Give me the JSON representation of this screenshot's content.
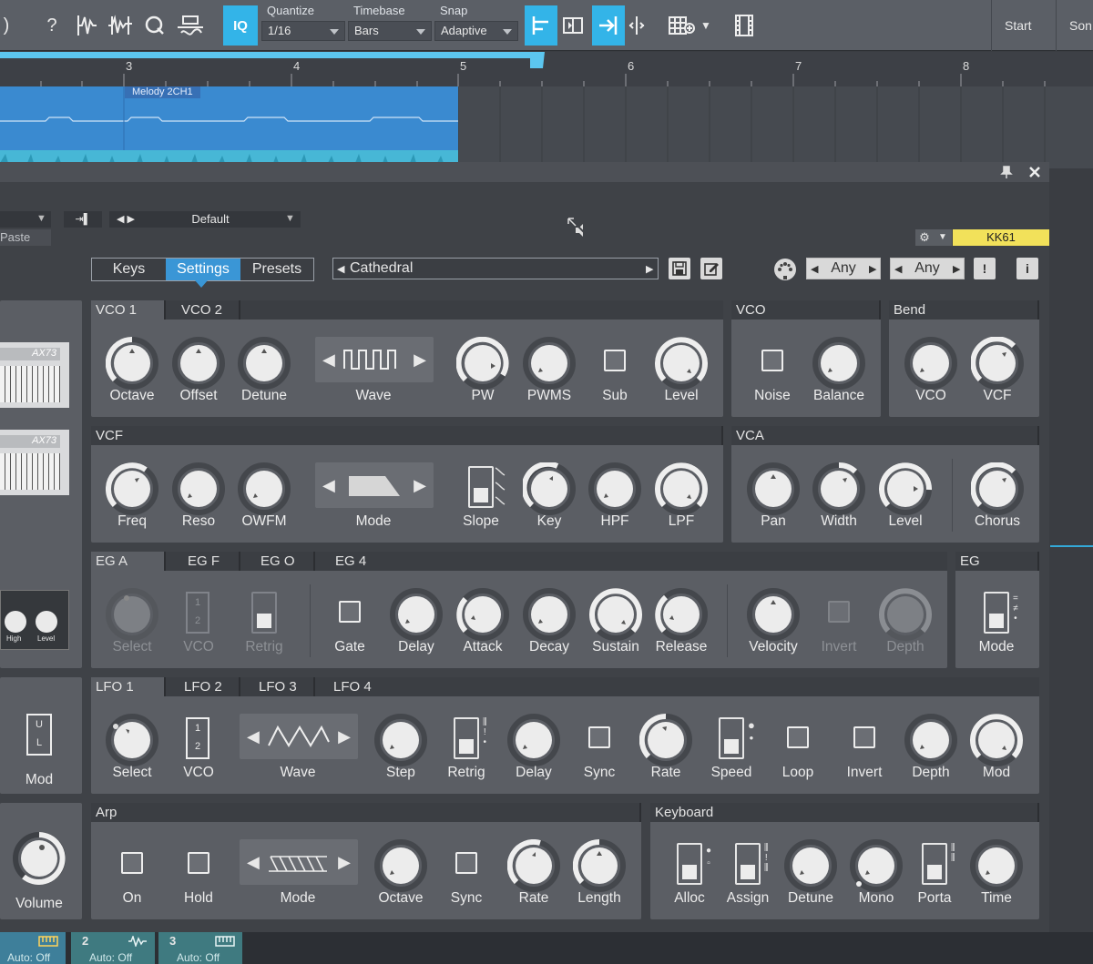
{
  "toolbar": {
    "quantize": {
      "label": "Quantize",
      "value": "1/16"
    },
    "timebase": {
      "label": "Timebase",
      "value": "Bars"
    },
    "snap": {
      "label": "Snap",
      "value": "Adaptive"
    },
    "iq_label": "IQ",
    "start_label": "Start",
    "song_label": "Son"
  },
  "ruler": {
    "bars": [
      "3",
      "4",
      "5",
      "6",
      "7",
      "8"
    ]
  },
  "clip": {
    "name": "Melody 2CH1"
  },
  "plugin": {
    "preset_default": "Default",
    "paste_label": "Paste",
    "device": "KK61",
    "tabs": [
      "Keys",
      "Settings",
      "Presets"
    ],
    "active_tab": "Settings",
    "preset_name": "Cathedral",
    "channel_any_1": "Any",
    "channel_any_2": "Any",
    "warn_label": "!",
    "info_label": "i"
  },
  "preview": {
    "model1": "AX73",
    "model2": "AX73",
    "knob_high": "High",
    "knob_level": "Level",
    "mod": "Mod",
    "volume": "Volume"
  },
  "vco": {
    "tabs": [
      "VCO 1",
      "VCO 2"
    ],
    "controls": {
      "octave": "Octave",
      "offset": "Offset",
      "detune": "Detune",
      "wave": "Wave",
      "pw": "PW",
      "pwms": "PWMS",
      "sub": "Sub",
      "level": "Level"
    }
  },
  "vco_mix": {
    "title": "VCO",
    "noise": "Noise",
    "balance": "Balance"
  },
  "bend": {
    "title": "Bend",
    "vco": "VCO",
    "vcf": "VCF"
  },
  "vcf": {
    "title": "VCF",
    "freq": "Freq",
    "reso": "Reso",
    "owfm": "OWFM",
    "mode": "Mode",
    "slope": "Slope",
    "key": "Key",
    "hpf": "HPF",
    "lpf": "LPF"
  },
  "vca": {
    "title": "VCA",
    "pan": "Pan",
    "width": "Width",
    "level": "Level",
    "chorus": "Chorus"
  },
  "eg": {
    "tabs": [
      "EG A",
      "EG F",
      "EG O",
      "EG 4"
    ],
    "select": "Select",
    "vco": "VCO",
    "retrig": "Retrig",
    "gate": "Gate",
    "delay": "Delay",
    "attack": "Attack",
    "decay": "Decay",
    "sustain": "Sustain",
    "release": "Release",
    "velocity": "Velocity",
    "invert": "Invert",
    "depth": "Depth"
  },
  "eg_mode": {
    "title": "EG",
    "mode": "Mode"
  },
  "lfo": {
    "tabs": [
      "LFO 1",
      "LFO 2",
      "LFO 3",
      "LFO 4"
    ],
    "select": "Select",
    "vco": "VCO",
    "wave": "Wave",
    "step": "Step",
    "retrig": "Retrig",
    "delay": "Delay",
    "sync": "Sync",
    "rate": "Rate",
    "speed": "Speed",
    "loop": "Loop",
    "invert": "Invert",
    "depth": "Depth",
    "mod": "Mod"
  },
  "arp": {
    "title": "Arp",
    "on": "On",
    "hold": "Hold",
    "mode": "Mode",
    "octave": "Octave",
    "sync": "Sync",
    "rate": "Rate",
    "length": "Length"
  },
  "keyboard": {
    "title": "Keyboard",
    "alloc": "Alloc",
    "assign": "Assign",
    "detune": "Detune",
    "mono": "Mono",
    "porta": "Porta",
    "time": "Time"
  },
  "bottom_tracks": [
    {
      "num": "",
      "auto": "Auto: Off"
    },
    {
      "num": "2",
      "auto": "Auto: Off"
    },
    {
      "num": "3",
      "auto": "Auto: Off"
    }
  ],
  "colors": {
    "accent": "#33b4e8",
    "device_badge": "#f2e15a",
    "panel": "#5b5e64",
    "clip": "#3a8ad0"
  }
}
